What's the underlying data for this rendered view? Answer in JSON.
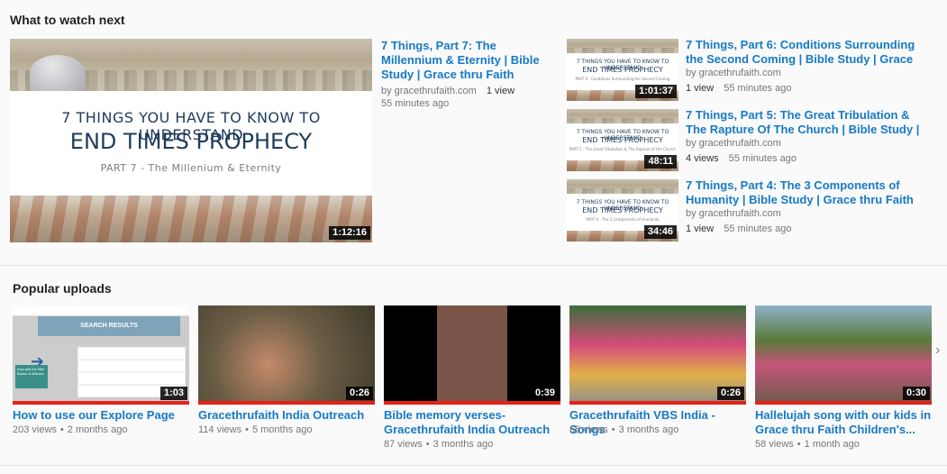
{
  "watch_next": {
    "title": "What to watch next",
    "featured": {
      "slide_line1": "7 THINGS YOU HAVE TO KNOW TO UNDERSTAND",
      "slide_line2": "END TIMES PROPHECY",
      "slide_line3": "PART 7 - The Millenium & Eternity",
      "duration": "1:12:16",
      "title": "7 Things, Part 7: The Millennium & Eternity | Bible Study | Grace thru Faith",
      "channel": "by gracethrufaith.com",
      "views": "1 view",
      "age": "55 minutes ago"
    },
    "side": [
      {
        "slide_line1": "7 THINGS YOU HAVE TO KNOW TO UNDERSTAND",
        "slide_line2": "END TIMES PROPHECY",
        "slide_line3": "PART 6 - Conditions Surrounding the Second Coming",
        "duration": "1:01:37",
        "title": "7 Things, Part 6: Conditions Surrounding the Second Coming | Bible Study | Grace thru Faith",
        "channel": "by gracethrufaith.com",
        "views": "1 view",
        "age": "55 minutes ago"
      },
      {
        "slide_line1": "7 THINGS YOU HAVE TO KNOW TO UNDERSTAND",
        "slide_line2": "END TIMES PROPHECY",
        "slide_line3": "PART 5 - The Great Tribulation & The Rapture of the Church",
        "duration": "48:11",
        "title": "7 Things, Part 5: The Great Tribulation & The Rapture Of The Church | Bible Study | Grace...",
        "channel": "by gracethrufaith.com",
        "views": "4 views",
        "age": "55 minutes ago"
      },
      {
        "slide_line1": "7 THINGS YOU HAVE TO KNOW TO UNDERSTAND",
        "slide_line2": "END TIMES PROPHECY",
        "slide_line3": "PART 4 - The 3 Components of Humanity",
        "duration": "34:46",
        "title": "7 Things, Part 4: The 3 Components of Humanity | Bible Study | Grace thru Faith",
        "channel": "by gracethrufaith.com",
        "views": "1 view",
        "age": "55 minutes ago"
      }
    ]
  },
  "popular": {
    "title": "Popular uploads",
    "next_icon": "chevron-right-icon",
    "items": [
      {
        "duration": "1:03",
        "title": "How to use our Explore Page",
        "views": "203 views",
        "age": "2 months ago",
        "thumb_text_heading": "SEARCH RESULTS",
        "thumb_text_note": "how add the filter Books & eBooks"
      },
      {
        "duration": "0:26",
        "title": "Gracethrufaith India Outreach",
        "views": "114 views",
        "age": "5 months ago"
      },
      {
        "duration": "0:39",
        "title": "Bible memory verses- Gracethrufaith India Outreach",
        "views": "87 views",
        "age": "3 months ago"
      },
      {
        "duration": "0:26",
        "title": "Gracethrufaith VBS India - Songs",
        "views": "65 views",
        "age": "3 months ago"
      },
      {
        "duration": "0:30",
        "title": "Hallelujah song with our kids in Grace thru Faith Children's...",
        "views": "58 views",
        "age": "1 month ago"
      }
    ]
  },
  "colors": {
    "link": "#167ac6",
    "progress": "#e62117",
    "meta": "#767676"
  }
}
